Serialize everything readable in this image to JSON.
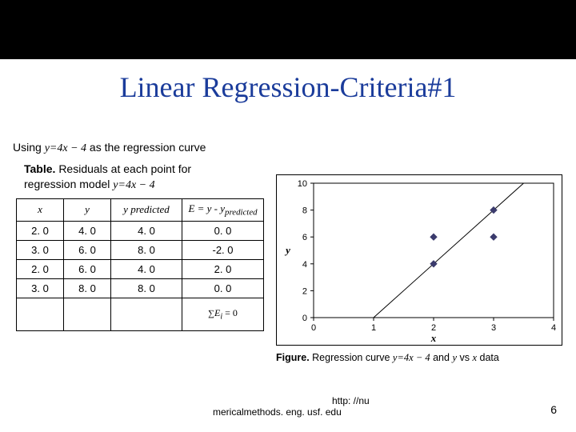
{
  "title": "Linear Regression-Criteria#1",
  "using_prefix": "Using",
  "using_eq": "y=4x − 4",
  "using_suffix": "as the regression curve",
  "table_caption_strong": "Table.",
  "table_caption_rest": "Residuals at each point for regression model",
  "table_caption_eq": "y=4x − 4",
  "headers": {
    "x": "x",
    "y": "y",
    "yp": "y predicted",
    "err_prefix": "E = y - y",
    "err_suffix": "predicted"
  },
  "rows": [
    {
      "x": "2. 0",
      "y": "4. 0",
      "yp": "4. 0",
      "e": "0. 0"
    },
    {
      "x": "3. 0",
      "y": "6. 0",
      "yp": "8. 0",
      "e": "-2. 0"
    },
    {
      "x": "2. 0",
      "y": "6. 0",
      "yp": "4. 0",
      "e": "2. 0"
    },
    {
      "x": "3. 0",
      "y": "8. 0",
      "yp": "8. 0",
      "e": "0. 0"
    }
  ],
  "sum_label": "ΣE_i = 0",
  "chart_data": {
    "type": "scatter+line",
    "xlabel": "x",
    "ylabel": "y",
    "xlim": [
      0,
      4
    ],
    "ylim": [
      0,
      10
    ],
    "xticks": [
      0,
      1,
      2,
      3,
      4
    ],
    "yticks": [
      0,
      2,
      4,
      6,
      8,
      10
    ],
    "points": [
      {
        "x": 2,
        "y": 4
      },
      {
        "x": 3,
        "y": 6
      },
      {
        "x": 2,
        "y": 6
      },
      {
        "x": 3,
        "y": 8
      }
    ],
    "line": {
      "m": 4,
      "b": -4,
      "x0": 1,
      "x1": 3.5
    }
  },
  "fig_caption_strong": "Figure.",
  "fig_caption_rest1": "Regression curve",
  "fig_caption_eq": "y=4x − 4",
  "fig_caption_rest2": "and y vs x data",
  "footer_url_line2": "http: //nu",
  "footer_url_line1": "mericalmethods. eng. usf. edu",
  "page_number": "6"
}
